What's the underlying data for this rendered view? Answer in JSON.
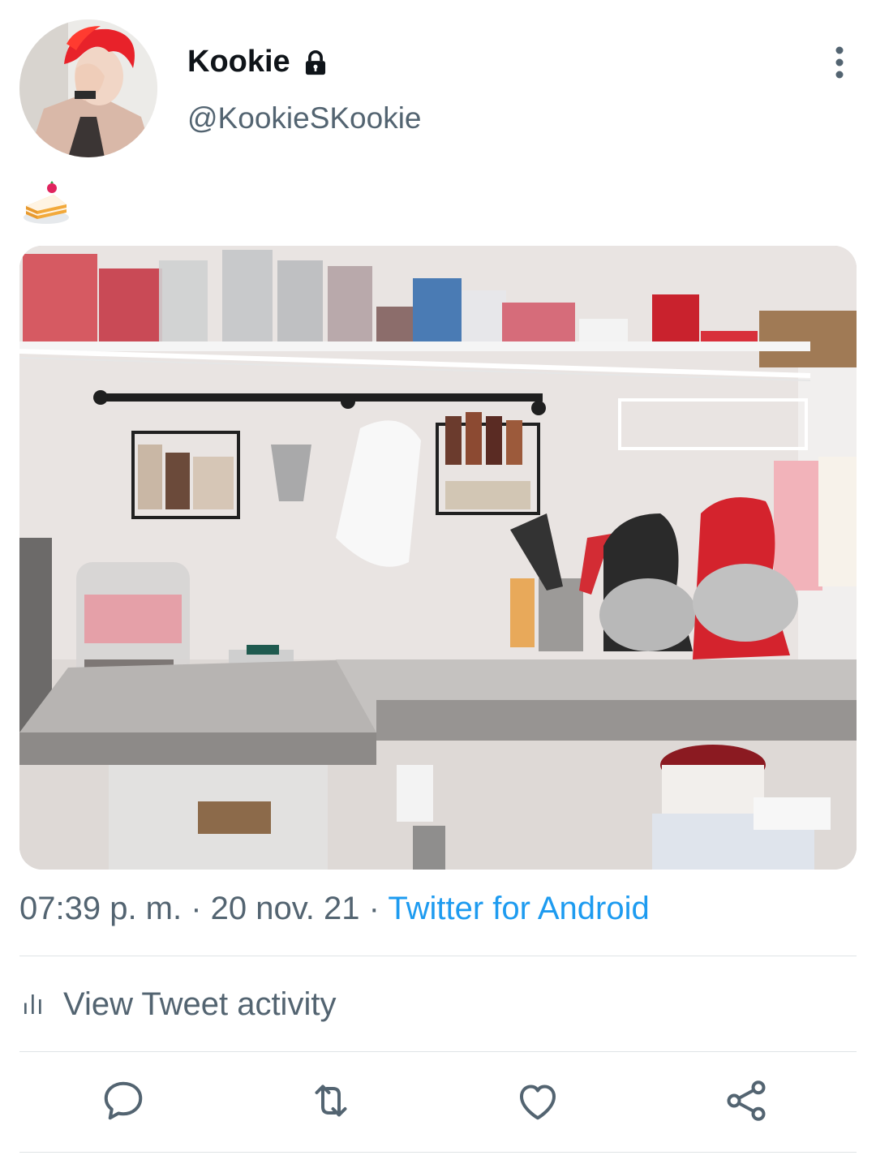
{
  "user": {
    "display_name": "Kookie",
    "handle": "@KookieSKookie",
    "protected_icon": "lock-icon"
  },
  "tweet": {
    "text_emoji": "cake-emoji",
    "media_description": "photo"
  },
  "meta": {
    "time": "07:39 p. m.",
    "separator1": " · ",
    "date": "20 nov. 21",
    "separator2": " · ",
    "source": "Twitter for Android"
  },
  "activity": {
    "label": "View Tweet activity",
    "icon": "bar-chart-icon"
  },
  "actions": [
    {
      "name": "reply",
      "icon": "speech-bubble-icon"
    },
    {
      "name": "retweet",
      "icon": "retweet-icon"
    },
    {
      "name": "like",
      "icon": "heart-icon"
    },
    {
      "name": "share",
      "icon": "share-icon"
    }
  ],
  "colors": {
    "text_primary": "#0f1419",
    "text_secondary": "#536471",
    "link": "#1d9bf0",
    "divider": "#dfe3e6",
    "icon": "#536471"
  }
}
